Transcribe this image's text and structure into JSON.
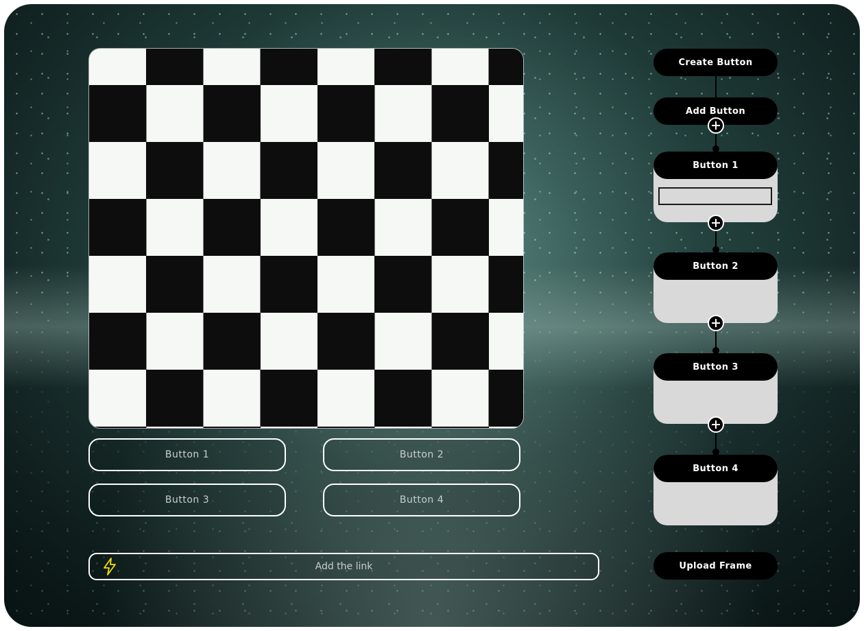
{
  "canvas": {
    "pattern": "checkerboard",
    "colors": {
      "dark": "#0d0d0d",
      "light": "#f6f8f6"
    }
  },
  "grid_buttons": [
    {
      "label": "Button 1"
    },
    {
      "label": "Button 2"
    },
    {
      "label": "Button 3"
    },
    {
      "label": "Button 4"
    }
  ],
  "link_input": {
    "placeholder": "Add the link",
    "icon": "lightning-bolt-icon",
    "icon_color": "#f5e100"
  },
  "flow": {
    "create_label": "Create Button",
    "add_label": "Add Button",
    "nodes": [
      {
        "label": "Button 1"
      },
      {
        "label": "Button 2"
      },
      {
        "label": "Button 3"
      },
      {
        "label": "Button 4"
      }
    ],
    "upload_label": "Upload Frame",
    "add_icon": "plus-circle-icon"
  },
  "colors": {
    "accent_bg": "#000000",
    "accent_text": "#ffffff",
    "card_bg": "#d9d9d9"
  }
}
